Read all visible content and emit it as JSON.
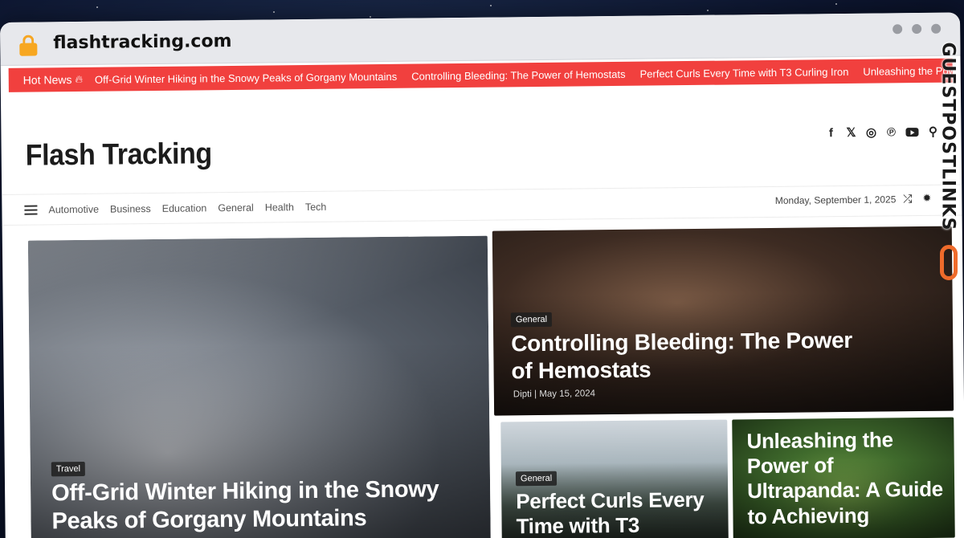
{
  "browser": {
    "url": "flashtracking.com"
  },
  "ticker": {
    "label": "Hot News",
    "items": [
      "Off-Grid Winter Hiking in the Snowy Peaks of Gorgany Mountains",
      "Controlling Bleeding: The Power of Hemostats",
      "Perfect Curls Every Time with T3 Curling Iron",
      "Unleashing the Power of Ultrapanda: A Guide"
    ]
  },
  "header": {
    "site_title": "Flash Tracking",
    "social_icons": [
      "facebook-icon",
      "x-icon",
      "instagram-icon",
      "pinterest-icon",
      "youtube-icon",
      "search-icon"
    ]
  },
  "nav": {
    "items": [
      "Automotive",
      "Business",
      "Education",
      "General",
      "Health",
      "Tech"
    ],
    "date": "Monday, September 1, 2025"
  },
  "posts": [
    {
      "category": "Travel",
      "title": "Off-Grid Winter Hiking in the Snowy Peaks of Gorgany Mountains"
    },
    {
      "category": "General",
      "title": "Controlling Bleeding: The Power of Hemostats",
      "author": "Dipti",
      "date": "May 15, 2024"
    },
    {
      "category": "General",
      "title": "Perfect Curls Every Time with T3"
    },
    {
      "title": "Unleashing the Power of Ultrapanda: A Guide to Achieving"
    }
  ],
  "watermark": {
    "text": "GUESTPOSTLINKS",
    "accent": "#ef6b2b"
  },
  "colors": {
    "ticker_bg": "#f1403e",
    "lock": "#f7a721"
  }
}
